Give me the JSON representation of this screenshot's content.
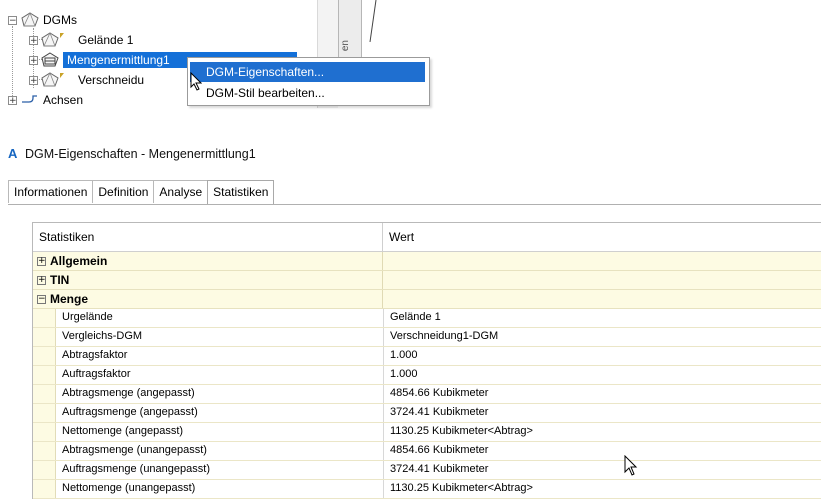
{
  "tree": {
    "root": {
      "label": "DGMs",
      "toggle": "−"
    },
    "items": [
      {
        "label": "Gelände 1",
        "toggle": "+"
      },
      {
        "label": "Mengenermittlung1",
        "toggle": "+"
      },
      {
        "label": "Verschneidu",
        "toggle": "+"
      }
    ],
    "achsen": {
      "label": "Achsen",
      "toggle": "+"
    }
  },
  "side_tab_text": "en",
  "context_menu": {
    "items": [
      {
        "label": "DGM-Eigenschaften..."
      },
      {
        "label": "DGM-Stil bearbeiten..."
      }
    ]
  },
  "dialog": {
    "app_letter": "A",
    "title": "DGM-Eigenschaften - Mengenermittlung1",
    "tabs": [
      {
        "label": "Informationen"
      },
      {
        "label": "Definition"
      },
      {
        "label": "Analyse"
      },
      {
        "label": "Statistiken"
      }
    ],
    "grid": {
      "columns": [
        "Statistiken",
        "Wert"
      ],
      "groups": [
        {
          "label": "Allgemein",
          "toggle": "+"
        },
        {
          "label": "TIN",
          "toggle": "+"
        },
        {
          "label": "Menge",
          "toggle": "−"
        }
      ],
      "rows": [
        {
          "name": "Urgelände",
          "value": "Gelände 1"
        },
        {
          "name": "Vergleichs-DGM",
          "value": "Verschneidung1-DGM"
        },
        {
          "name": "Abtragsfaktor",
          "value": "1.000"
        },
        {
          "name": "Auftragsfaktor",
          "value": "1.000"
        },
        {
          "name": "Abtragsmenge (angepasst)",
          "value": "4854.66 Kubikmeter"
        },
        {
          "name": "Auftragsmenge (angepasst)",
          "value": "3724.41 Kubikmeter"
        },
        {
          "name": "Nettomenge (angepasst)",
          "value": "1130.25 Kubikmeter<Abtrag>"
        },
        {
          "name": "Abtragsmenge (unangepasst)",
          "value": "4854.66 Kubikmeter"
        },
        {
          "name": "Auftragsmenge (unangepasst)",
          "value": "3724.41 Kubikmeter"
        },
        {
          "name": "Nettomenge (unangepasst)",
          "value": "1130.25 Kubikmeter<Abtrag>"
        }
      ]
    }
  },
  "colors": {
    "selection": "#1470d8",
    "menu_highlight": "#1f6fd0",
    "grid_group_bg": "#fdfbe3",
    "app_icon": "#1565c0"
  }
}
